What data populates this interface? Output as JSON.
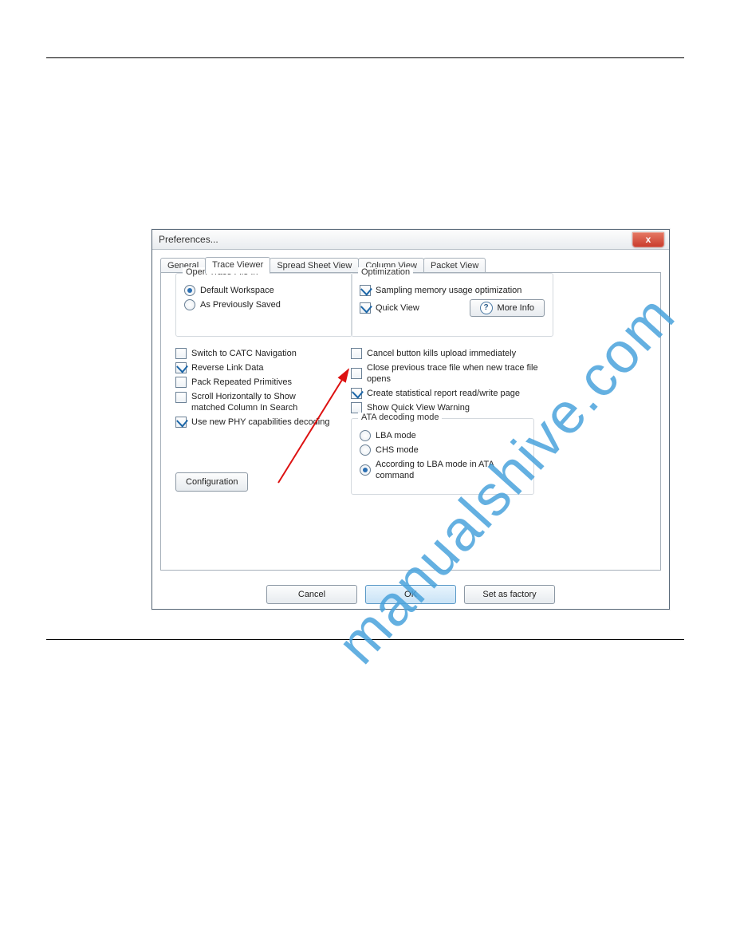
{
  "watermark": "manualshive.com",
  "dialog": {
    "title": "Preferences...",
    "tabs": [
      "General",
      "Trace Viewer",
      "Spread Sheet View",
      "Column View",
      "Packet View"
    ],
    "active_tab": "Trace Viewer",
    "open_trace_group": {
      "legend": "Open Trace File In",
      "options": [
        "Default Workspace",
        "As Previously Saved"
      ],
      "selected": 0
    },
    "optimization_group": {
      "legend": "Optimization",
      "sampling_label": "Sampling memory usage optimization",
      "sampling_checked": true,
      "quickview_label": "Quick View",
      "quickview_checked": true,
      "more_info_label": "More Info"
    },
    "left_checks": [
      {
        "label": "Switch to CATC Navigation",
        "checked": false
      },
      {
        "label": "Reverse Link Data",
        "checked": true
      },
      {
        "label": "Pack Repeated Primitives",
        "checked": false
      },
      {
        "label": "Scroll Horizontally to Show matched Column In Search",
        "checked": false
      },
      {
        "label": "Use new PHY capabilities decoding",
        "checked": true
      }
    ],
    "right_checks": [
      {
        "label": "Cancel button kills upload immediately",
        "checked": false
      },
      {
        "label": "Close previous trace file when new trace file opens",
        "checked": false
      },
      {
        "label": "Create statistical report read/write page",
        "checked": true
      },
      {
        "label": "Show Quick View Warning",
        "checked": false
      }
    ],
    "ata_group": {
      "legend": "ATA decoding mode",
      "options": [
        "LBA mode",
        "CHS mode",
        "According to LBA mode in ATA command"
      ],
      "selected": 2
    },
    "configuration_label": "Configuration",
    "buttons": {
      "cancel": "Cancel",
      "ok": "OK",
      "set_factory": "Set as factory"
    }
  }
}
